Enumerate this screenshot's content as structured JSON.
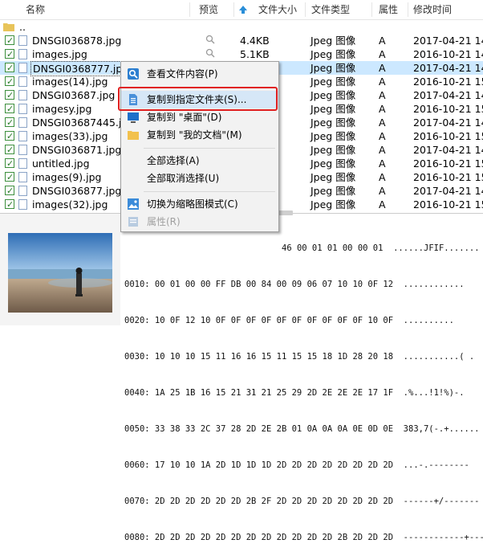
{
  "header": {
    "col_name": "名称",
    "col_preview": "预览",
    "col_size": "文件大小",
    "col_type": "文件类型",
    "col_attr": "属性",
    "col_mtime": "修改时间"
  },
  "parent_row": "..",
  "rows": [
    {
      "name": "DNSGI036878.jpg",
      "size": "4.4KB",
      "type": "Jpeg 图像",
      "attr": "A",
      "date": "2017-04-21 14:"
    },
    {
      "name": "images.jpg",
      "size": "5.1KB",
      "type": "Jpeg 图像",
      "attr": "A",
      "date": "2016-10-21 14:"
    },
    {
      "name": "DNSGI0368777.jpg",
      "size": "",
      "type": "Jpeg 图像",
      "attr": "A",
      "date": "2017-04-21 14:"
    },
    {
      "name": "images(14).jpg",
      "size": "",
      "type": "Jpeg 图像",
      "attr": "A",
      "date": "2016-10-21 15:"
    },
    {
      "name": "DNSGI03687.jpg",
      "size": "",
      "type": "Jpeg 图像",
      "attr": "A",
      "date": "2017-04-21 14:"
    },
    {
      "name": "imagesy.jpg",
      "size": "",
      "type": "Jpeg 图像",
      "attr": "A",
      "date": "2016-10-21 15:"
    },
    {
      "name": "DNSGI03687445.jpg",
      "size": "",
      "type": "Jpeg 图像",
      "attr": "A",
      "date": "2017-04-21 14:"
    },
    {
      "name": "images(33).jpg",
      "size": "",
      "type": "Jpeg 图像",
      "attr": "A",
      "date": "2016-10-21 15:"
    },
    {
      "name": "DNSGI036871.jpg",
      "size": "",
      "type": "Jpeg 图像",
      "attr": "A",
      "date": "2017-04-21 14:"
    },
    {
      "name": "untitled.jpg",
      "size": "",
      "type": "Jpeg 图像",
      "attr": "A",
      "date": "2016-10-21 15:"
    },
    {
      "name": "images(9).jpg",
      "size": "",
      "type": "Jpeg 图像",
      "attr": "A",
      "date": "2016-10-21 15:"
    },
    {
      "name": "DNSGI036877.jpg",
      "size": "",
      "type": "Jpeg 图像",
      "attr": "A",
      "date": "2017-04-21 14:"
    },
    {
      "name": "images(32).jpg",
      "size": "",
      "type": "Jpeg 图像",
      "attr": "A",
      "date": "2016-10-21 15:"
    }
  ],
  "context_menu": {
    "view_content": "查看文件内容(P)",
    "copy_to_folder": "复制到指定文件夹(S)...",
    "copy_to_desktop": "复制到 \"桌面\"(D)",
    "copy_to_mydocs": "复制到 \"我的文档\"(M)",
    "select_all": "全部选择(A)",
    "deselect_all": "全部取消选择(U)",
    "toggle_thumbs": "切换为缩略图模式(C)",
    "properties": "属性(R)"
  },
  "hex": {
    "line0": "46 00 01 01 00 00 01  ......JFIF.......",
    "lines": [
      "0010: 00 01 00 00 FF DB 00 84 00 09 06 07 10 10 0F 12  ............",
      "0020: 10 0F 12 10 0F 0F 0F 0F 0F 0F 0F 0F 0F 0F 10 0F  ..........",
      "0030: 10 10 10 15 11 16 16 15 11 15 15 18 1D 28 20 18  ...........( .",
      "0040: 1A 25 1B 16 15 21 31 21 25 29 2D 2E 2E 2E 17 1F  .%...!1!%)-.",
      "0050: 33 38 33 2C 37 28 2D 2E 2B 01 0A 0A 0A 0E 0D 0E  383,7(-.+......",
      "0060: 17 10 10 1A 2D 1D 1D 1D 2D 2D 2D 2D 2D 2D 2D 2D  ...-.--------",
      "0070: 2D 2D 2D 2D 2D 2D 2B 2F 2D 2D 2D 2D 2D 2D 2D 2D  ------+/-------",
      "0080: 2D 2D 2D 2D 2D 2D 2D 2D 2D 2D 2D 2D 2B 2D 2D 2D  ------------+---"
    ]
  }
}
